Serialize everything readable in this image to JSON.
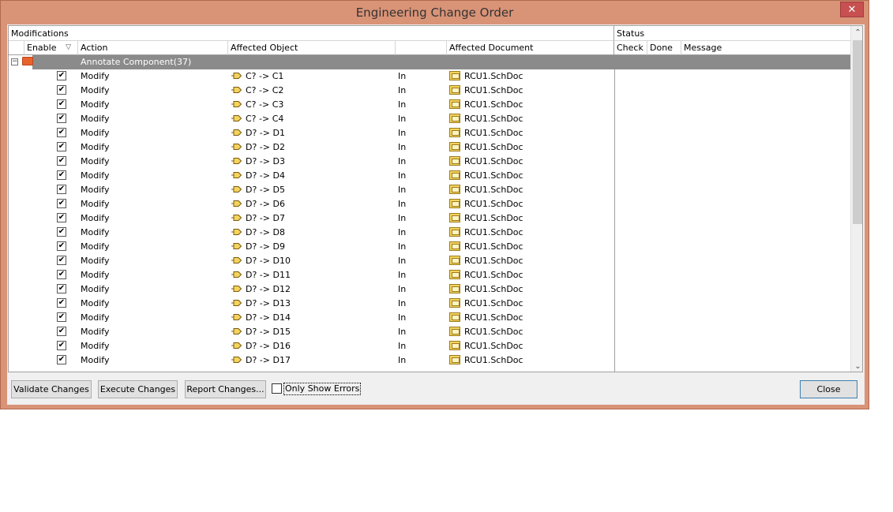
{
  "window": {
    "title": "Engineering Change Order",
    "close_glyph": "✕"
  },
  "grid": {
    "modifications_label": "Modifications",
    "status_label": "Status",
    "columns": {
      "enable": "Enable",
      "action": "Action",
      "affected_object": "Affected Object",
      "affected_document": "Affected Document",
      "check": "Check",
      "done": "Done",
      "message": "Message"
    },
    "group": {
      "label": "Annotate Component(37)",
      "expander": "−"
    },
    "rows": [
      {
        "checked": "✔",
        "action": "Modify",
        "object": "C? -> C1",
        "in": "In",
        "document": "RCU1.SchDoc"
      },
      {
        "checked": "✔",
        "action": "Modify",
        "object": "C? -> C2",
        "in": "In",
        "document": "RCU1.SchDoc"
      },
      {
        "checked": "✔",
        "action": "Modify",
        "object": "C? -> C3",
        "in": "In",
        "document": "RCU1.SchDoc"
      },
      {
        "checked": "✔",
        "action": "Modify",
        "object": "C? -> C4",
        "in": "In",
        "document": "RCU1.SchDoc"
      },
      {
        "checked": "✔",
        "action": "Modify",
        "object": "D? -> D1",
        "in": "In",
        "document": "RCU1.SchDoc"
      },
      {
        "checked": "✔",
        "action": "Modify",
        "object": "D? -> D2",
        "in": "In",
        "document": "RCU1.SchDoc"
      },
      {
        "checked": "✔",
        "action": "Modify",
        "object": "D? -> D3",
        "in": "In",
        "document": "RCU1.SchDoc"
      },
      {
        "checked": "✔",
        "action": "Modify",
        "object": "D? -> D4",
        "in": "In",
        "document": "RCU1.SchDoc"
      },
      {
        "checked": "✔",
        "action": "Modify",
        "object": "D? -> D5",
        "in": "In",
        "document": "RCU1.SchDoc"
      },
      {
        "checked": "✔",
        "action": "Modify",
        "object": "D? -> D6",
        "in": "In",
        "document": "RCU1.SchDoc"
      },
      {
        "checked": "✔",
        "action": "Modify",
        "object": "D? -> D7",
        "in": "In",
        "document": "RCU1.SchDoc"
      },
      {
        "checked": "✔",
        "action": "Modify",
        "object": "D? -> D8",
        "in": "In",
        "document": "RCU1.SchDoc"
      },
      {
        "checked": "✔",
        "action": "Modify",
        "object": "D? -> D9",
        "in": "In",
        "document": "RCU1.SchDoc"
      },
      {
        "checked": "✔",
        "action": "Modify",
        "object": "D? -> D10",
        "in": "In",
        "document": "RCU1.SchDoc"
      },
      {
        "checked": "✔",
        "action": "Modify",
        "object": "D? -> D11",
        "in": "In",
        "document": "RCU1.SchDoc"
      },
      {
        "checked": "✔",
        "action": "Modify",
        "object": "D? -> D12",
        "in": "In",
        "document": "RCU1.SchDoc"
      },
      {
        "checked": "✔",
        "action": "Modify",
        "object": "D? -> D13",
        "in": "In",
        "document": "RCU1.SchDoc"
      },
      {
        "checked": "✔",
        "action": "Modify",
        "object": "D? -> D14",
        "in": "In",
        "document": "RCU1.SchDoc"
      },
      {
        "checked": "✔",
        "action": "Modify",
        "object": "D? -> D15",
        "in": "In",
        "document": "RCU1.SchDoc"
      },
      {
        "checked": "✔",
        "action": "Modify",
        "object": "D? -> D16",
        "in": "In",
        "document": "RCU1.SchDoc"
      },
      {
        "checked": "✔",
        "action": "Modify",
        "object": "D? -> D17",
        "in": "In",
        "document": "RCU1.SchDoc"
      }
    ],
    "scroll_up": "⌃",
    "scroll_down": "⌄"
  },
  "buttons": {
    "validate": "Validate Changes",
    "execute": "Execute Changes",
    "report": "Report Changes...",
    "only_show_errors": "Only Show Errors",
    "close": "Close"
  },
  "colors": {
    "frame": "#d99377",
    "group_row": "#8b8b8b",
    "close_button": "#c75050"
  }
}
